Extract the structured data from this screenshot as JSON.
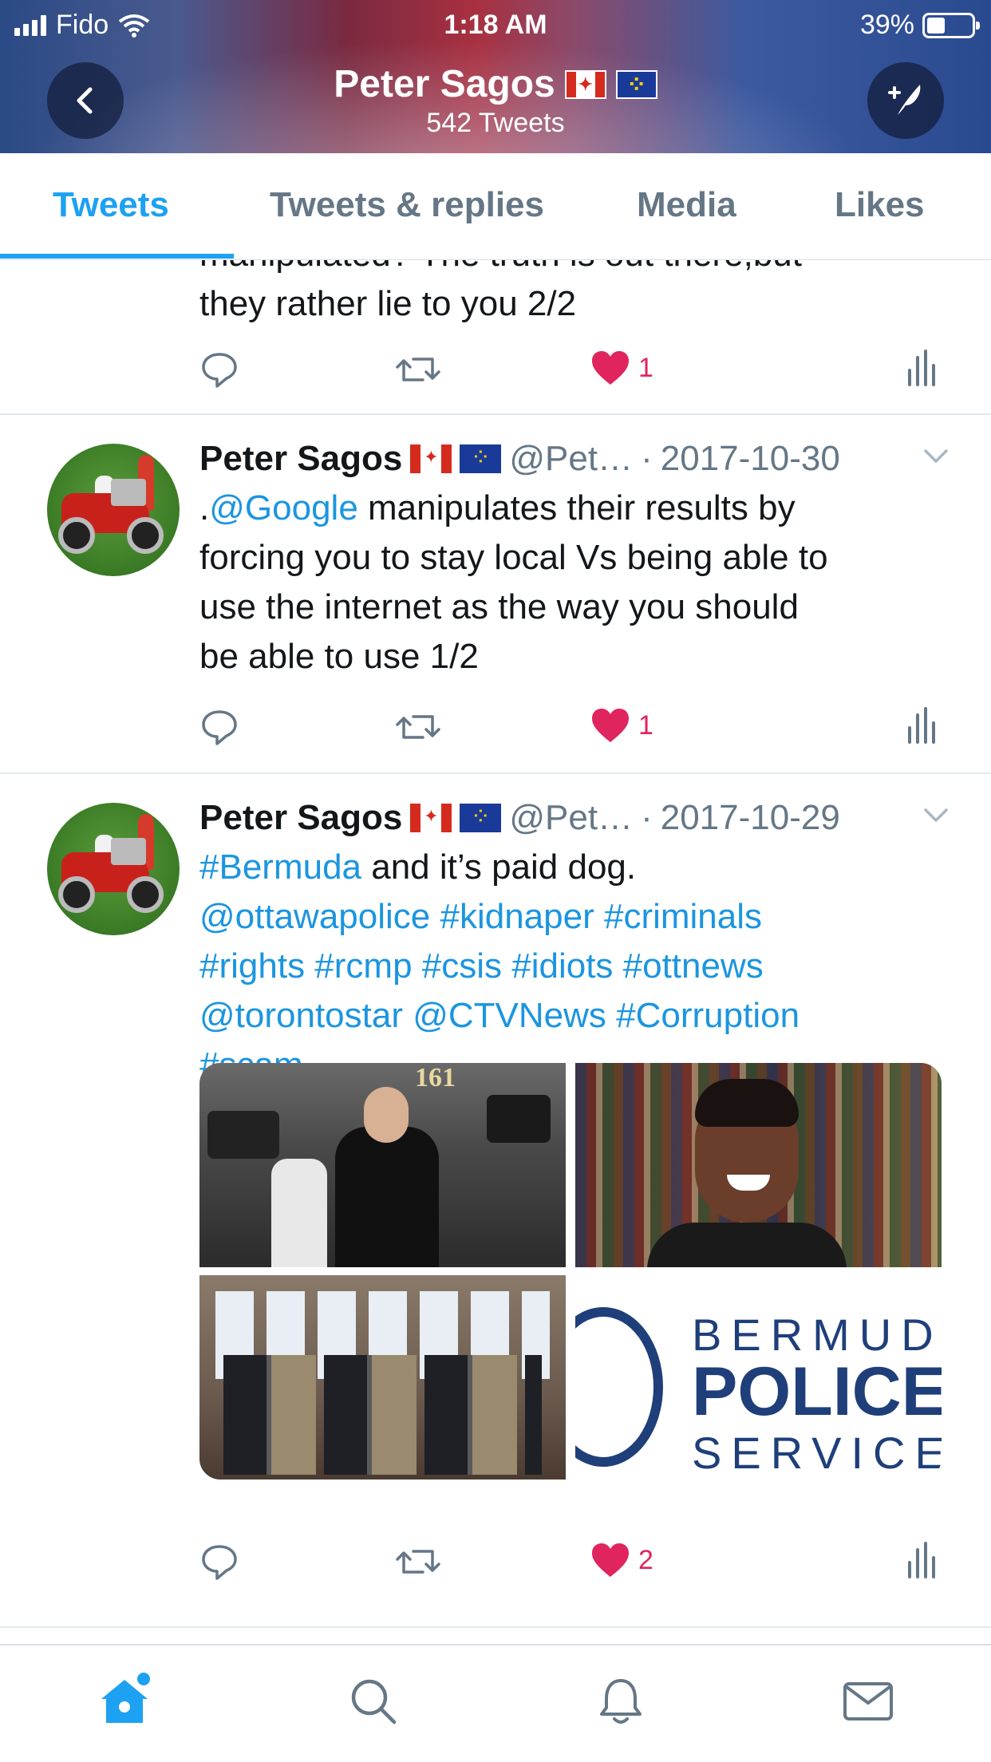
{
  "status_bar": {
    "carrier": "Fido",
    "time": "1:18 AM",
    "battery": "39%",
    "battery_level": 0.39
  },
  "header": {
    "profile_name": "Peter Sagos",
    "tweet_count": "542 Tweets",
    "back_icon": "chevron-left-icon",
    "compose_icon": "compose-tweet-icon"
  },
  "tabs": [
    {
      "label": "Tweets",
      "active": true
    },
    {
      "label": "Tweets & replies",
      "active": false
    },
    {
      "label": "Media",
      "active": false
    },
    {
      "label": "Likes",
      "active": false
    }
  ],
  "partial_tweet": {
    "line1": "manipulated? The truth is out there,but",
    "line2": "they rather lie to you 2/2",
    "likes": "1"
  },
  "tweets": [
    {
      "author": "Peter Sagos",
      "handle": "@Pet…",
      "separator": "·",
      "date": "2017-10-30",
      "text_prefix": ".",
      "mention": "@Google",
      "text_line1_rest": " manipulates their results by",
      "text_line2": "forcing you to stay local Vs being able to",
      "text_line3": "use the internet as the way you should",
      "text_line4": "be able to use 1/2",
      "likes": "1"
    },
    {
      "author": "Peter Sagos",
      "handle": "@Pet…",
      "separator": "·",
      "date": "2017-10-29",
      "hashtag_bermuda": "#Bermuda",
      "text_line1_rest": " and it’s paid dog.",
      "text_line2": "@ottawapolice #kidnaper #criminals",
      "text_line3": "#rights #rcmp #csis #idiots #ottnews",
      "text_line4": "@torontostar @CTVNews #Corruption",
      "text_line5": "#scam",
      "media": {
        "photo1_number": "161",
        "logo_line1": "BERMUDA",
        "logo_line2": "POLICE",
        "logo_line3": "SERVICE"
      },
      "likes": "2"
    }
  ],
  "bottom_nav": [
    "home-icon",
    "search-icon",
    "notifications-icon",
    "messages-icon"
  ],
  "colors": {
    "accent": "#1da1f2",
    "link": "#1b95e0",
    "like": "#e0245e",
    "secondary_text": "#657786"
  }
}
